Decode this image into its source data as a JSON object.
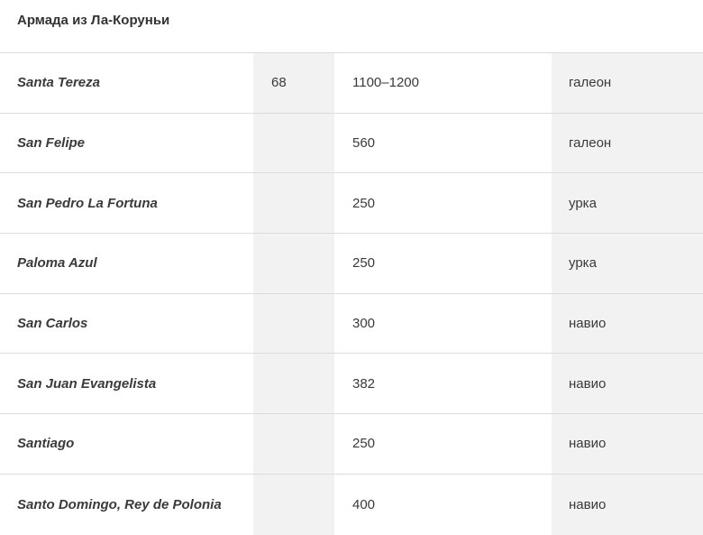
{
  "caption": "Армада из Ла-Коруньи",
  "rows": [
    {
      "name": "Santa Tereza",
      "guns": "68",
      "tons": "1100–1200",
      "type": "галеон"
    },
    {
      "name": "San Felipe",
      "guns": "",
      "tons": "560",
      "type": "галеон"
    },
    {
      "name": "San Pedro La Fortuna",
      "guns": "",
      "tons": "250",
      "type": "урка"
    },
    {
      "name": "Paloma Azul",
      "guns": "",
      "tons": "250",
      "type": "урка"
    },
    {
      "name": "San Carlos",
      "guns": "",
      "tons": "300",
      "type": "навио"
    },
    {
      "name": "San Juan Evangelista",
      "guns": "",
      "tons": "382",
      "type": "навио"
    },
    {
      "name": "Santiago",
      "guns": "",
      "tons": "250",
      "type": "навио"
    },
    {
      "name": "Santo Domingo, Rey de Polonia",
      "guns": "",
      "tons": "400",
      "type": "навио"
    }
  ]
}
